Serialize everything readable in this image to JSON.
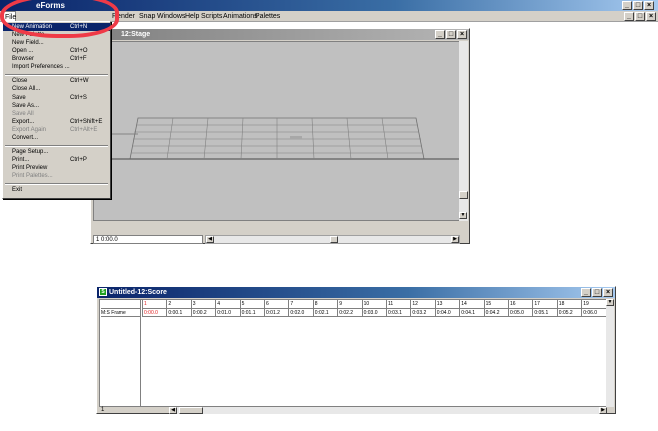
{
  "app": {
    "title": "eForms",
    "menus": [
      "File",
      "Render",
      "Snap",
      "Windows",
      "Help",
      "Scripts",
      "Animations",
      "Palettes"
    ]
  },
  "file_menu": {
    "items": [
      {
        "label": "New Animation",
        "shortcut": "Ctrl+N",
        "state": "highlighted"
      },
      {
        "label": "New Palette",
        "shortcut": "",
        "state": "normal"
      },
      {
        "label": "New Field...",
        "shortcut": "",
        "state": "normal"
      },
      {
        "label": "Open ...",
        "shortcut": "Ctrl+O",
        "state": "normal"
      },
      {
        "label": "Browser",
        "shortcut": "Ctrl+F",
        "state": "normal"
      },
      {
        "label": "Import Preferences ...",
        "shortcut": "",
        "state": "normal"
      },
      {
        "label": "Close",
        "shortcut": "Ctrl+W",
        "state": "normal"
      },
      {
        "label": "Close All...",
        "shortcut": "",
        "state": "normal"
      },
      {
        "label": "Save",
        "shortcut": "Ctrl+S",
        "state": "normal"
      },
      {
        "label": "Save As...",
        "shortcut": "",
        "state": "normal"
      },
      {
        "label": "Save All",
        "shortcut": "",
        "state": "disabled"
      },
      {
        "label": "Export...",
        "shortcut": "Ctrl+Shift+E",
        "state": "normal"
      },
      {
        "label": "Export Again",
        "shortcut": "Ctrl+Alt+E",
        "state": "disabled"
      },
      {
        "label": "Convert...",
        "shortcut": "",
        "state": "normal"
      },
      {
        "label": "Page Setup...",
        "shortcut": "",
        "state": "normal"
      },
      {
        "label": "Print...",
        "shortcut": "Ctrl+P",
        "state": "normal"
      },
      {
        "label": "Print Preview",
        "shortcut": "",
        "state": "normal"
      },
      {
        "label": "Print Palettes...",
        "shortcut": "",
        "state": "disabled"
      },
      {
        "label": "Exit",
        "shortcut": "",
        "state": "normal"
      }
    ]
  },
  "stage": {
    "title": "12:Stage",
    "status": "1 0:00.0"
  },
  "score": {
    "title": "Untitled-12:Score",
    "row_label": "M:S Frame",
    "frame_numbers": [
      "1",
      "2",
      "3",
      "4",
      "5",
      "6",
      "7",
      "8",
      "9",
      "10",
      "11",
      "12",
      "13",
      "14",
      "15",
      "16",
      "17",
      "18",
      "19"
    ],
    "timecodes": [
      "0:00.0",
      "0:00.1",
      "0:00.2",
      "0:01.0",
      "0:01.1",
      "0:01.2",
      "0:02.0",
      "0:02.1",
      "0:02.2",
      "0:03.0",
      "0:03.1",
      "0:03.2",
      "0:04.0",
      "0:04.1",
      "0:04.2",
      "0:05.0",
      "0:05.1",
      "0:05.2",
      "0:06.0"
    ],
    "status_frame": "1"
  },
  "colors": {
    "highlight_ring": "#ef3a47",
    "current_frame": "#e02020",
    "title_active": "#0a246a"
  }
}
